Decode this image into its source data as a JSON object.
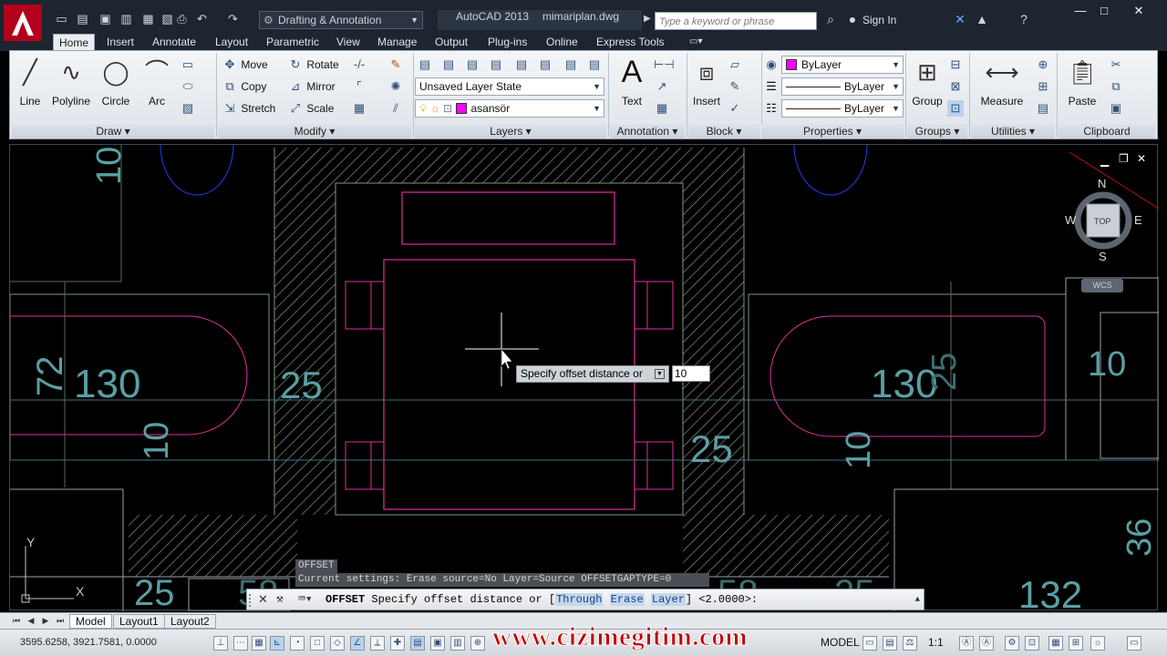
{
  "titlebar": {
    "workspace": "Drafting & Annotation",
    "app_name": "AutoCAD 2013",
    "file_name": "mimariplan.dwg",
    "search_placeholder": "Type a keyword or phrase",
    "sign_in": "Sign In"
  },
  "ribbon": {
    "tabs": [
      "Home",
      "Insert",
      "Annotate",
      "Layout",
      "Parametric",
      "View",
      "Manage",
      "Output",
      "Plug-ins",
      "Online",
      "Express Tools"
    ],
    "active_tab": "Home",
    "draw": {
      "title": "Draw",
      "line": "Line",
      "polyline": "Polyline",
      "circle": "Circle",
      "arc": "Arc"
    },
    "modify": {
      "title": "Modify",
      "move": "Move",
      "rotate": "Rotate",
      "copy": "Copy",
      "mirror": "Mirror",
      "stretch": "Stretch",
      "scale": "Scale"
    },
    "layers": {
      "title": "Layers",
      "layer_state": "Unsaved Layer State",
      "current_layer": "asansör"
    },
    "annotation": {
      "title": "Annotation",
      "text": "Text"
    },
    "block": {
      "title": "Block",
      "insert": "Insert"
    },
    "properties": {
      "title": "Properties",
      "color": "ByLayer",
      "linetype": "ByLayer",
      "lineweight": "ByLayer"
    },
    "groups": {
      "title": "Groups",
      "group": "Group"
    },
    "utilities": {
      "title": "Utilities",
      "measure": "Measure"
    },
    "clipboard": {
      "title": "Clipboard",
      "paste": "Paste"
    }
  },
  "drawing": {
    "dimensions": [
      "10",
      "72",
      "130",
      "10",
      "25",
      "25",
      "130",
      "10",
      "10",
      "25",
      "58",
      "58",
      "25",
      "25",
      "132",
      "36"
    ],
    "viewcube": {
      "north": "N",
      "south": "S",
      "east": "E",
      "west": "W",
      "top": "TOP"
    },
    "wcs": "WCS",
    "ucs": {
      "x": "X",
      "y": "Y"
    }
  },
  "tooltip": {
    "prompt": "Specify offset distance or",
    "input_value": "10"
  },
  "command": {
    "history_1": "OFFSET",
    "history_2": "Current settings: Erase source=No  Layer=Source  OFFSETGAPTYPE=0",
    "name": "OFFSET",
    "prompt_pre": " Specify offset distance or [",
    "opt_through": "Through",
    "opt_erase": "Erase",
    "opt_layer": "Layer",
    "prompt_post": "] <2.0000>:"
  },
  "layout_tabs": [
    "Model",
    "Layout1",
    "Layout2"
  ],
  "statusbar": {
    "coords": "3595.6258, 3921.7581, 0.0000",
    "model": "MODEL",
    "scale": "1:1"
  },
  "watermark": "www.cizimegitim.com"
}
